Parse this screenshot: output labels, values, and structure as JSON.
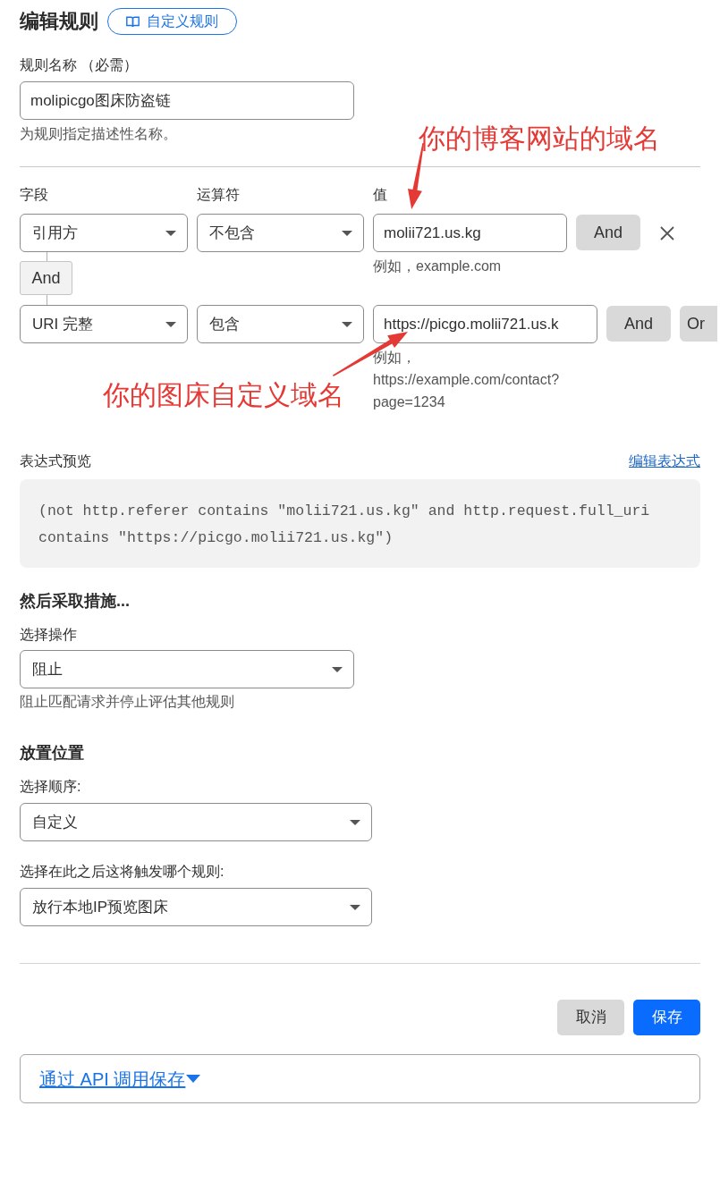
{
  "header": {
    "title": "编辑规则",
    "badge": "自定义规则"
  },
  "rule_name": {
    "label": "规则名称 （必需）",
    "value": "molipicgo图床防盗链",
    "hint": "为规则指定描述性名称。"
  },
  "conditions": {
    "columns": [
      "字段",
      "运算符",
      "值"
    ],
    "rows": [
      {
        "field": "引用方",
        "operator": "不包含",
        "value": "molii721.us.kg",
        "hint": "例如，example.com",
        "actions": [
          {
            "kind": "logic",
            "label": "And"
          },
          {
            "kind": "remove"
          }
        ]
      },
      {
        "connector": "And",
        "field": "URI 完整",
        "operator": "包含",
        "value": "https://picgo.molii721.us.k",
        "hint": "例如，https://example.com/contact?page=1234",
        "actions": [
          {
            "kind": "logic",
            "label": "And"
          },
          {
            "kind": "logic",
            "label": "Or"
          }
        ]
      }
    ]
  },
  "expression": {
    "label": "表达式预览",
    "edit_link": "编辑表达式",
    "code": "(not http.referer contains \"molii721.us.kg\" and http.request.full_uri contains \"https://picgo.molii721.us.kg\")"
  },
  "action": {
    "heading": "然后采取措施...",
    "label": "选择操作",
    "value": "阻止",
    "hint": "阻止匹配请求并停止评估其他规则"
  },
  "placement": {
    "heading": "放置位置",
    "fields": [
      {
        "label": "选择顺序:",
        "value": "自定义"
      },
      {
        "label": "选择在此之后这将触发哪个规则:",
        "value": "放行本地IP预览图床"
      }
    ]
  },
  "footer_buttons": [
    {
      "label": "取消",
      "kind": "secondary"
    },
    {
      "label": "保存",
      "kind": "primary"
    }
  ],
  "api_panel": {
    "link": "通过 API 调用保存",
    "expanded": false
  },
  "annotations": [
    {
      "text": "你的博客网站的域名"
    },
    {
      "text": "你的图床自定义域名"
    }
  ]
}
